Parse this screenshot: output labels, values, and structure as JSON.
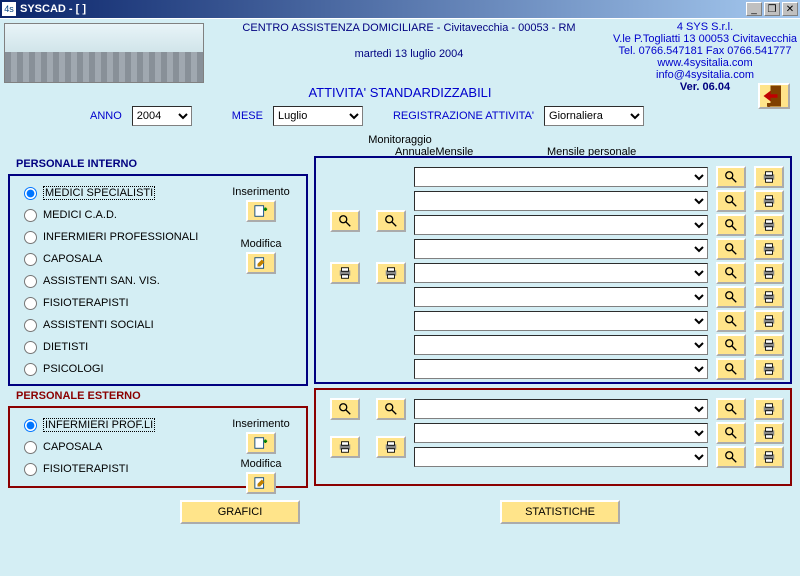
{
  "window": {
    "title": "SYSCAD - [ ]"
  },
  "header": {
    "line1": "CENTRO ASSISTENZA DOMICILIARE   -   Civitavecchia   -   00053   -   RM",
    "date": "martedì 13 luglio 2004",
    "company": {
      "name": "4 SYS S.r.l.",
      "addr": "V.le P.Togliatti 13 00053  Civitavecchia",
      "phones": "Tel. 0766.547181   Fax  0766.541777",
      "web": "www.4sysitalia.com  info@4sysitalia.com",
      "ver": "Ver. 06.04"
    }
  },
  "title": "ATTIVITA' STANDARDIZZABILI",
  "filters": {
    "anno_label": "ANNO",
    "anno_value": "2004",
    "mese_label": "MESE",
    "mese_value": "Luglio",
    "reg_label": "REGISTRAZIONE ATTIVITA'",
    "reg_value": "Giornaliera"
  },
  "monitor": {
    "title": "Monitoraggio",
    "col_annuale": "Annuale",
    "col_mensile": "Mensile",
    "col_mensile_pers": "Mensile personale"
  },
  "actions": {
    "inserimento": "Inserimento",
    "modifica": "Modifica"
  },
  "interno": {
    "title": "PERSONALE INTERNO",
    "roles": [
      "MEDICI SPECIALISTI",
      "MEDICI C.A.D.",
      "INFERMIERI PROFESSIONALI",
      "CAPOSALA",
      "ASSISTENTI SAN. VIS.",
      "FISIOTERAPISTI",
      "ASSISTENTI SOCIALI",
      "DIETISTI",
      "PSICOLOGI"
    ],
    "selected": 0
  },
  "esterno": {
    "title": "PERSONALE ESTERNO",
    "roles": [
      "INFERMIERI PROF.LI",
      "CAPOSALA",
      "FISIOTERAPISTI"
    ],
    "selected": 0
  },
  "buttons": {
    "grafici": "GRAFICI",
    "statistiche": "STATISTICHE"
  }
}
